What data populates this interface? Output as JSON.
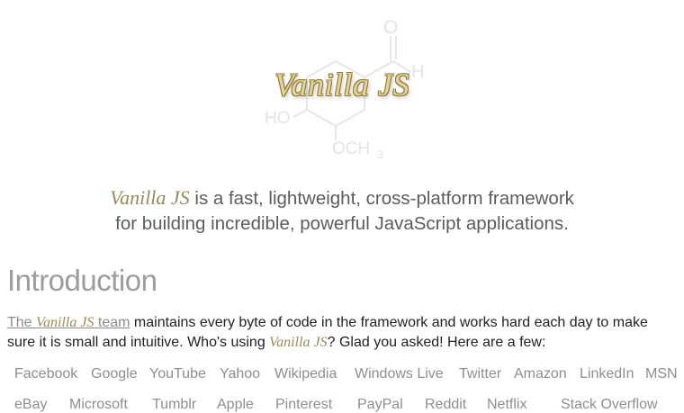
{
  "hero": {
    "logo_text": "Vanilla JS",
    "molecule": {
      "oxygen": "O",
      "hydrogen": "H",
      "hydroxyl": "HO",
      "methoxy": "OCH",
      "subscript": "3"
    }
  },
  "tagline": {
    "brand": "Vanilla JS",
    "line1": " is a fast, lightweight, cross-platform framework",
    "line2": "for building incredible, powerful JavaScript applications."
  },
  "introduction": {
    "title": "Introduction",
    "link_prefix": "The ",
    "link_brand": "Vanilla JS",
    "link_suffix": " team",
    "text1": " maintains every byte of code in the framework and works hard each day to make sure it is small and intuitive. Who's using ",
    "brand": "Vanilla JS",
    "text2": "? Glad you asked! Here are a few:"
  },
  "users": {
    "row1": [
      "Facebook",
      "Google",
      "YouTube",
      "Yahoo",
      "Wikipedia",
      "Windows Live",
      "Twitter",
      "Amazon",
      "LinkedIn",
      "MSN"
    ],
    "row2": [
      "eBay",
      "Microsoft",
      "Tumblr",
      "Apple",
      "Pinterest",
      "PayPal",
      "Reddit",
      "Netflix",
      "Stack Overflow"
    ]
  }
}
